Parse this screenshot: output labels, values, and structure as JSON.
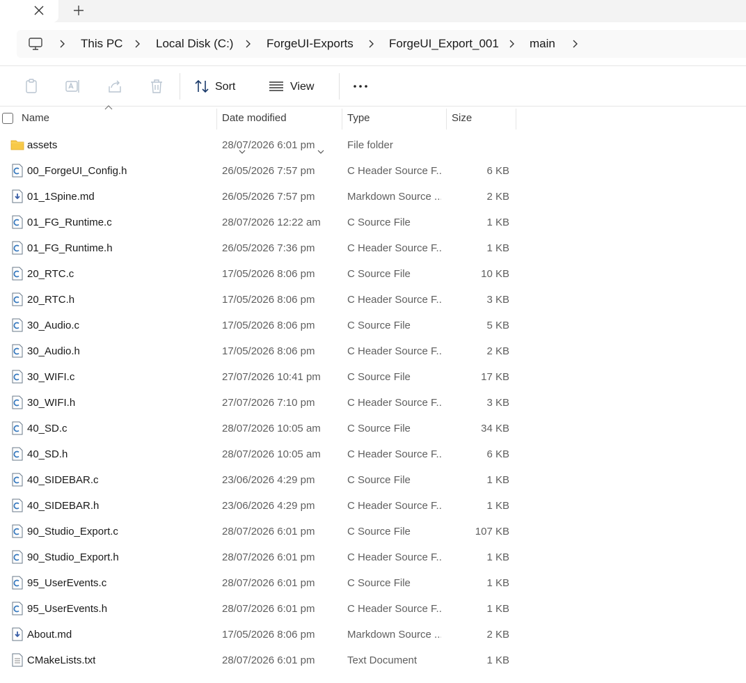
{
  "breadcrumb": [
    "This PC",
    "Local Disk (C:)",
    "ForgeUI-Exports",
    "ForgeUI_Export_001",
    "main"
  ],
  "toolbar": {
    "sort_label": "Sort",
    "view_label": "View"
  },
  "columns": {
    "name": "Name",
    "date": "Date modified",
    "type": "Type",
    "size": "Size"
  },
  "colors": {
    "folder": "#f7c948",
    "c_icon": "#3a7bbf",
    "md_icon": "#3a5fa8"
  },
  "files": [
    {
      "name": "assets",
      "date": "28/07/2026 6:01 pm",
      "type": "File folder",
      "size": "",
      "icon": "folder-icon"
    },
    {
      "name": "00_ForgeUI_Config.h",
      "date": "26/05/2026 7:57 pm",
      "type": "C Header Source F...",
      "size": "6 KB",
      "icon": "c-file-icon"
    },
    {
      "name": "01_1Spine.md",
      "date": "26/05/2026 7:57 pm",
      "type": "Markdown Source ...",
      "size": "2 KB",
      "icon": "markdown-file-icon"
    },
    {
      "name": "01_FG_Runtime.c",
      "date": "28/07/2026 12:22 am",
      "type": "C Source File",
      "size": "1 KB",
      "icon": "c-file-icon"
    },
    {
      "name": "01_FG_Runtime.h",
      "date": "26/05/2026 7:36 pm",
      "type": "C Header Source F...",
      "size": "1 KB",
      "icon": "c-file-icon"
    },
    {
      "name": "20_RTC.c",
      "date": "17/05/2026 8:06 pm",
      "type": "C Source File",
      "size": "10 KB",
      "icon": "c-file-icon"
    },
    {
      "name": "20_RTC.h",
      "date": "17/05/2026 8:06 pm",
      "type": "C Header Source F...",
      "size": "3 KB",
      "icon": "c-file-icon"
    },
    {
      "name": "30_Audio.c",
      "date": "17/05/2026 8:06 pm",
      "type": "C Source File",
      "size": "5 KB",
      "icon": "c-file-icon"
    },
    {
      "name": "30_Audio.h",
      "date": "17/05/2026 8:06 pm",
      "type": "C Header Source F...",
      "size": "2 KB",
      "icon": "c-file-icon"
    },
    {
      "name": "30_WIFI.c",
      "date": "27/07/2026 10:41 pm",
      "type": "C Source File",
      "size": "17 KB",
      "icon": "c-file-icon"
    },
    {
      "name": "30_WIFI.h",
      "date": "27/07/2026 7:10 pm",
      "type": "C Header Source F...",
      "size": "3 KB",
      "icon": "c-file-icon"
    },
    {
      "name": "40_SD.c",
      "date": "28/07/2026 10:05 am",
      "type": "C Source File",
      "size": "34 KB",
      "icon": "c-file-icon"
    },
    {
      "name": "40_SD.h",
      "date": "28/07/2026 10:05 am",
      "type": "C Header Source F...",
      "size": "6 KB",
      "icon": "c-file-icon"
    },
    {
      "name": "40_SIDEBAR.c",
      "date": "23/06/2026 4:29 pm",
      "type": "C Source File",
      "size": "1 KB",
      "icon": "c-file-icon"
    },
    {
      "name": "40_SIDEBAR.h",
      "date": "23/06/2026 4:29 pm",
      "type": "C Header Source F...",
      "size": "1 KB",
      "icon": "c-file-icon"
    },
    {
      "name": "90_Studio_Export.c",
      "date": "28/07/2026 6:01 pm",
      "type": "C Source File",
      "size": "107 KB",
      "icon": "c-file-icon"
    },
    {
      "name": "90_Studio_Export.h",
      "date": "28/07/2026 6:01 pm",
      "type": "C Header Source F...",
      "size": "1 KB",
      "icon": "c-file-icon"
    },
    {
      "name": "95_UserEvents.c",
      "date": "28/07/2026 6:01 pm",
      "type": "C Source File",
      "size": "1 KB",
      "icon": "c-file-icon"
    },
    {
      "name": "95_UserEvents.h",
      "date": "28/07/2026 6:01 pm",
      "type": "C Header Source F...",
      "size": "1 KB",
      "icon": "c-file-icon"
    },
    {
      "name": "About.md",
      "date": "17/05/2026 8:06 pm",
      "type": "Markdown Source ...",
      "size": "2 KB",
      "icon": "markdown-file-icon"
    },
    {
      "name": "CMakeLists.txt",
      "date": "28/07/2026 6:01 pm",
      "type": "Text Document",
      "size": "1 KB",
      "icon": "text-file-icon"
    }
  ]
}
